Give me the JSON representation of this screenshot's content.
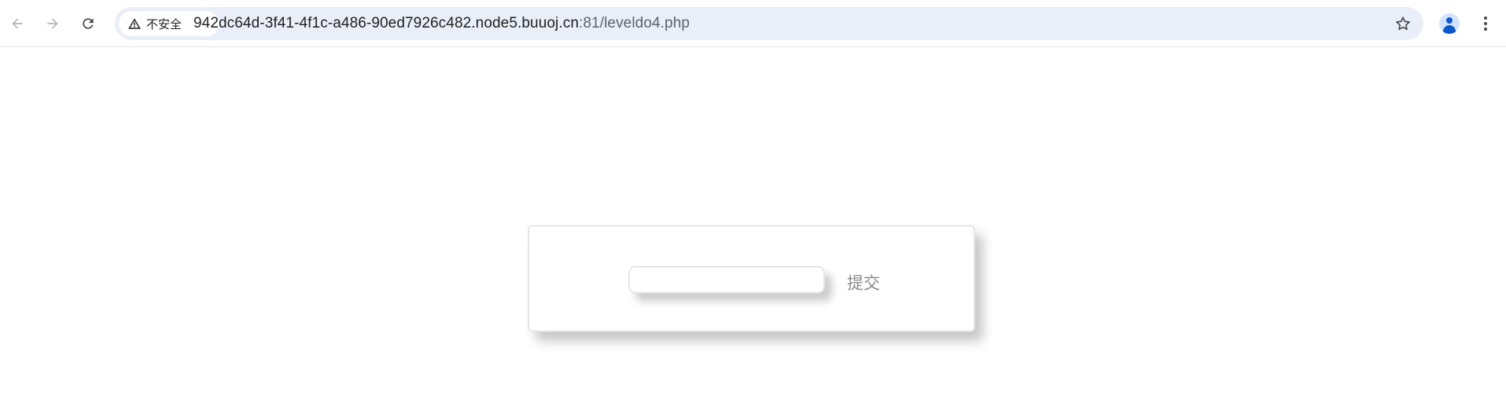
{
  "browser": {
    "security_label": "不安全",
    "url_host": "942dc64d-3f41-4f1c-a486-90ed7926c482.node5.buuoj.cn",
    "url_rest": ":81/leveldo4.php",
    "icons": {
      "back": "arrow-left-icon",
      "forward": "arrow-right-icon",
      "reload": "reload-icon",
      "security": "warning-triangle-icon",
      "bookmark": "star-icon",
      "profile": "profile-avatar-icon",
      "menu": "more-vertical-icon"
    }
  },
  "form": {
    "input_value": "",
    "submit_label": "提交"
  },
  "colors": {
    "omnibox_bg": "#e9eef8",
    "profile_accent": "#0b57d0",
    "submit_text": "#8a8a8a"
  }
}
